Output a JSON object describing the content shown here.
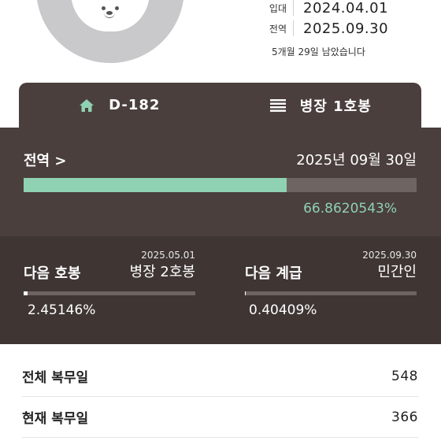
{
  "profile": {
    "enlist_label": "입대",
    "enlist_date": "2024.04.01",
    "discharge_label": "전역",
    "discharge_date": "2025.09.30",
    "remaining": "5개월 29일 남았습니다"
  },
  "tabs": [
    {
      "icon": "home-icon",
      "label": "D-182"
    },
    {
      "icon": "menu-icon",
      "label": "병장 1호봉"
    }
  ],
  "discharge": {
    "title": "전역 >",
    "date": "2025년 09월 30일",
    "progress_percent": 66.8620543,
    "percent_text": "66.8620543%"
  },
  "next_pay": {
    "title": "다음 호봉",
    "date": "2025.05.01",
    "rank": "병장 2호봉",
    "progress_percent": 2.45146,
    "percent_text": "2.45146%"
  },
  "next_rank": {
    "title": "다음 계급",
    "date": "2025.09.30",
    "rank": "민간인",
    "progress_percent": 0.40409,
    "percent_text": "0.40409%"
  },
  "stats": [
    {
      "label": "전체 복무일",
      "value": "548"
    },
    {
      "label": "현재 복무일",
      "value": "366"
    }
  ],
  "colors": {
    "card_dark": "#4a3f3d",
    "card_darker": "#3f3634",
    "accent_mint": "#8fd1b3",
    "track": "#6e6462"
  }
}
